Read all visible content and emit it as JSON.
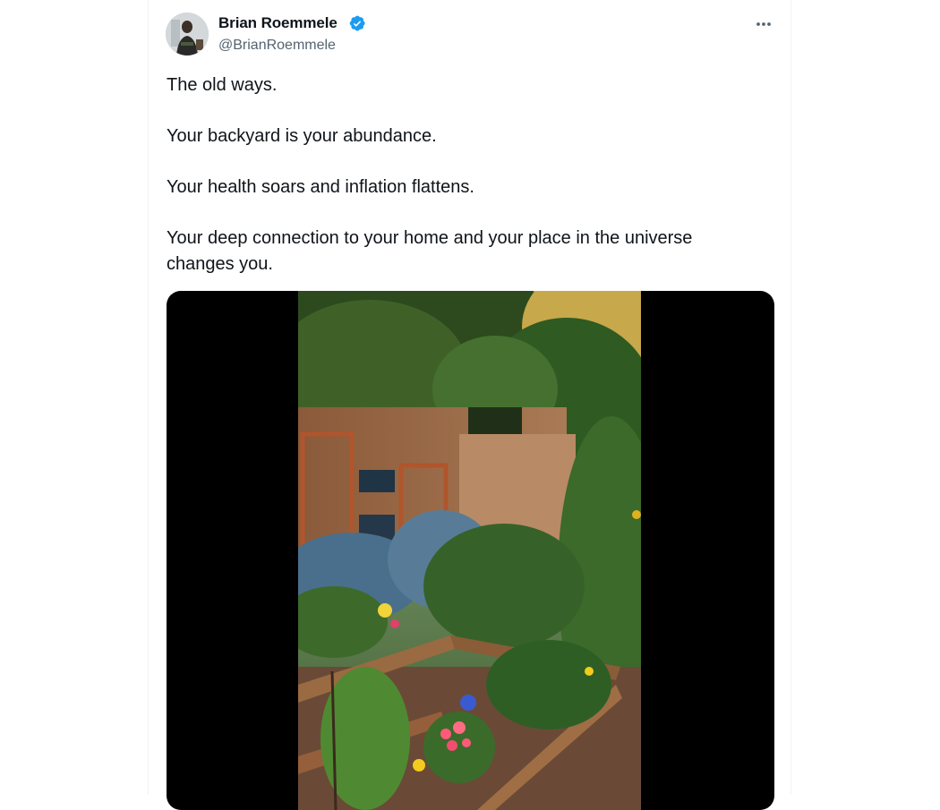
{
  "author": {
    "display_name": "Brian Roemmele",
    "handle": "@BrianRoemmele",
    "verified": true,
    "avatar_icon": "profile-photo"
  },
  "tweet": {
    "paragraphs": [
      "The old ways.",
      "Your backyard is your abundance.",
      "Your health soars and inflation flattens.",
      "Your deep connection to your home and your place in the universe changes you."
    ]
  },
  "actions": {
    "more_icon": "more-horizontal-icon"
  },
  "media": {
    "type": "video",
    "icon": "video-thumbnail"
  },
  "colors": {
    "text": "#0f1419",
    "secondary": "#536471",
    "verified": "#1d9bf0",
    "border": "#eff3f4"
  }
}
